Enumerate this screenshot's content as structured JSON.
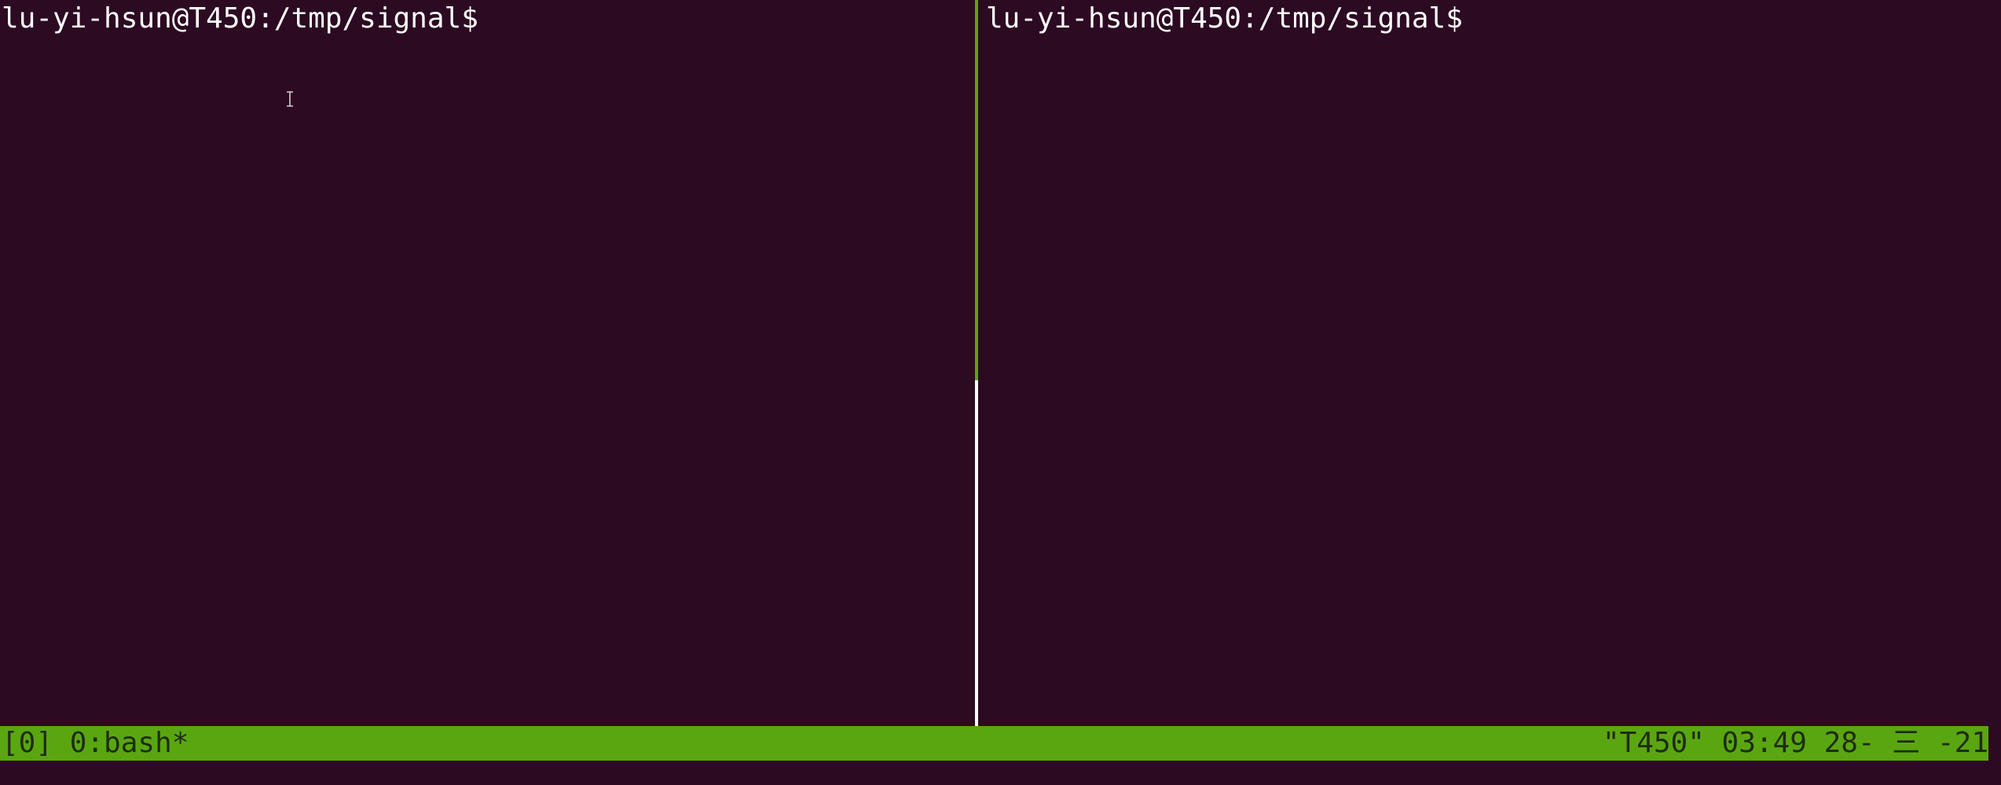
{
  "left_pane": {
    "prompt": "lu-yi-hsun@T450:/tmp/signal$"
  },
  "right_pane": {
    "prompt": "lu-yi-hsun@T450:/tmp/signal$"
  },
  "status_bar": {
    "session": "[0] 0:bash*",
    "right_info": "\"T450\" 03:49 28- 三 -21"
  },
  "colors": {
    "background": "#2c0a22",
    "status_bar": "#5aa611",
    "active_border": "#5aa611",
    "inactive_border": "#ffffff",
    "text": "#ffffff"
  }
}
